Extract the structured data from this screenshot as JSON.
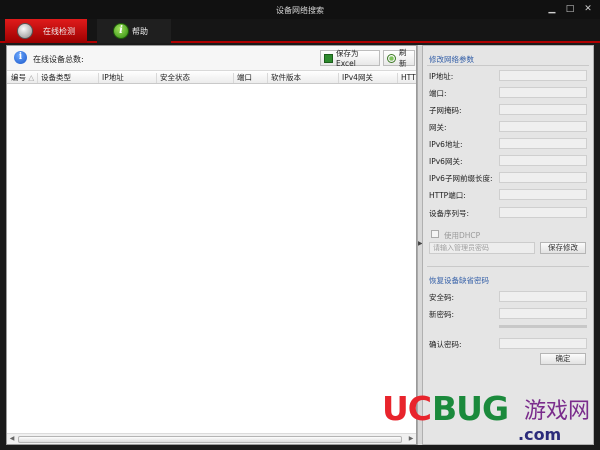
{
  "window": {
    "title": "设备网络搜索"
  },
  "tabs": [
    {
      "label": "在线检测"
    },
    {
      "label": "帮助"
    }
  ],
  "toolbar": {
    "count_label": "在线设备总数:",
    "excel_label": "保存为Excel",
    "refresh_label": "刷新"
  },
  "table": {
    "columns": [
      "编号",
      "设备类型",
      "IP地址",
      "安全状态",
      "端口",
      "软件版本",
      "IPv4网关",
      "HTT"
    ]
  },
  "network": {
    "title": "修改网络参数",
    "fields": [
      "IP地址:",
      "端口:",
      "子网掩码:",
      "网关:",
      "IPv6地址:",
      "IPv6网关:",
      "IPv6子网前缀长度:",
      "HTTP端口:",
      "设备序列号:"
    ],
    "dhcp_label": "使用DHCP",
    "admin_pwd_placeholder": "请输入管理员密码",
    "save_label": "保存修改"
  },
  "reset": {
    "title": "恢复设备缺省密码",
    "fields": [
      "安全码:",
      "新密码:",
      "确认密码:"
    ],
    "ok_label": "确定"
  },
  "watermark": {
    "uc": "UC",
    "bug": "BUG",
    "cn": "游戏网",
    "com": ".com"
  },
  "colors": {
    "tab_active": "#c40000",
    "section_title": "#3560a8",
    "accent_bar": "#b00000"
  }
}
